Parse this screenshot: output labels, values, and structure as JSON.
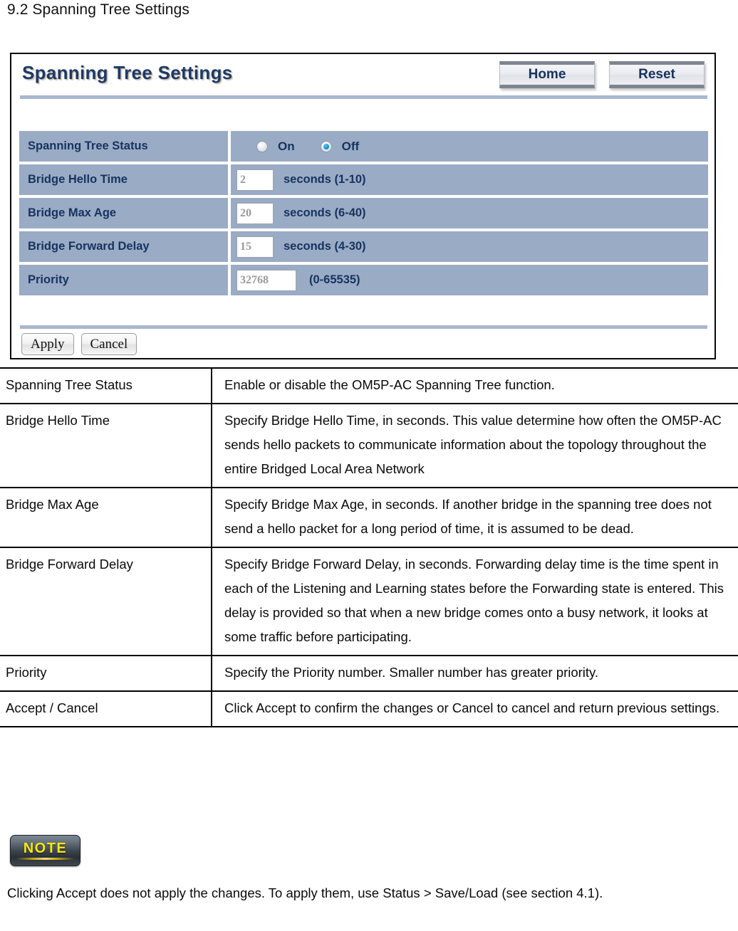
{
  "section_heading": "9.2 Spanning Tree Settings",
  "panel": {
    "title": "Spanning Tree Settings",
    "nav_buttons": [
      {
        "label": "Home"
      },
      {
        "label": "Reset"
      }
    ],
    "rows": [
      {
        "label": "Spanning Tree Status",
        "type": "radio",
        "options": [
          {
            "label": "On",
            "checked": false
          },
          {
            "label": "Off",
            "checked": true
          }
        ]
      },
      {
        "label": "Bridge Hello Time",
        "type": "text",
        "value": "2",
        "unit": "seconds (1-10)"
      },
      {
        "label": "Bridge Max Age",
        "type": "text",
        "value": "20",
        "unit": "seconds (6-40)"
      },
      {
        "label": "Bridge Forward Delay",
        "type": "text",
        "value": "15",
        "unit": "seconds (4-30)"
      },
      {
        "label": "Priority",
        "type": "text",
        "value": "32768",
        "unit": "(0-65535)"
      }
    ],
    "actions": [
      {
        "label": "Apply"
      },
      {
        "label": "Cancel"
      }
    ]
  },
  "description_table": {
    "rows": [
      {
        "term": "Spanning Tree Status",
        "definition": "Enable or disable the OM5P-AC Spanning Tree function."
      },
      {
        "term": "Bridge Hello Time",
        "definition": "Specify Bridge Hello Time, in seconds. This value determine how often the OM5P-AC sends hello packets to communicate information about the topology throughout the entire Bridged Local Area Network"
      },
      {
        "term": "Bridge Max Age",
        "definition": "Specify Bridge Max Age, in seconds. If another bridge in the spanning tree does not send a hello packet for a long period of time, it is assumed to be dead."
      },
      {
        "term": "Bridge Forward Delay",
        "definition": "Specify Bridge Forward Delay, in seconds. Forwarding delay time is the time spent in each of the Listening and Learning states before the Forwarding state is entered. This delay is provided so that when a new bridge comes onto a busy network, it looks at some traffic before participating."
      },
      {
        "term": "Priority",
        "definition": "Specify the Priority number. Smaller number has greater priority."
      },
      {
        "term": "Accept / Cancel",
        "definition": "Click Accept to confirm the changes or Cancel to cancel and return previous settings."
      }
    ]
  },
  "note": {
    "badge_label": "NOTE",
    "text": "Clicking Accept does not apply the changes. To apply them, use Status > Save/Load (see section 4.1)."
  },
  "colors": {
    "row_background": "#9aabc5",
    "row_text": "#16335f",
    "panel_title": "#1b3a6b",
    "rule": "#a8b7cf",
    "radio_selected": "#109ad6",
    "note_text": "#f7e80f"
  }
}
